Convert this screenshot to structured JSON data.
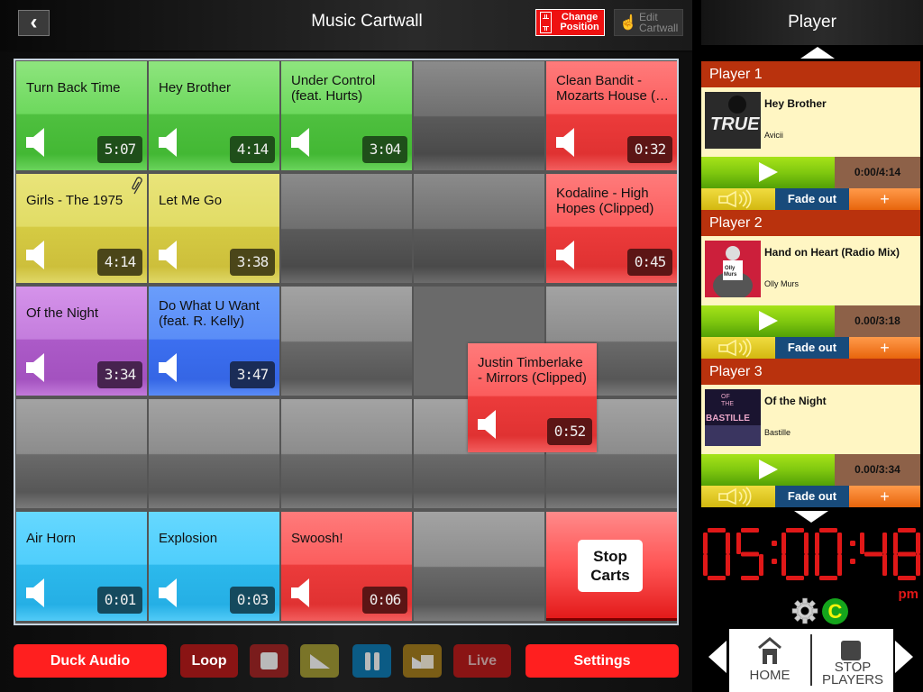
{
  "header": {
    "title": "Music Cartwall",
    "back_label": "‹",
    "change_position_label": "Change Position",
    "edit_cartwall_label": "Edit Cartwall"
  },
  "grid": {
    "cells": [
      {
        "name": "Turn Back Time",
        "duration": "5:07",
        "color": "green"
      },
      {
        "name": "Hey Brother",
        "duration": "4:14",
        "color": "green"
      },
      {
        "name": "Under Control (feat. Hurts)",
        "duration": "3:04",
        "color": "green"
      },
      {
        "name": "",
        "duration": "",
        "color": "empty"
      },
      {
        "name": "Clean Bandit - Mozarts House (…",
        "duration": "0:32",
        "color": "red"
      },
      {
        "name": "Girls - The 1975",
        "duration": "4:14",
        "color": "yellow",
        "attachment": true
      },
      {
        "name": "Let Me Go",
        "duration": "3:38",
        "color": "yellow"
      },
      {
        "name": "",
        "duration": "",
        "color": "empty"
      },
      {
        "name": "",
        "duration": "",
        "color": "empty"
      },
      {
        "name": "Kodaline - High Hopes (Clipped)",
        "duration": "0:45",
        "color": "red"
      },
      {
        "name": "Of the Night",
        "duration": "3:34",
        "color": "purple"
      },
      {
        "name": "Do What U Want (feat. R. Kelly)",
        "duration": "3:47",
        "color": "blue"
      },
      {
        "name": "",
        "duration": "",
        "color": "empty"
      },
      {
        "name": "",
        "duration": "",
        "color": "hole"
      },
      {
        "name": "",
        "duration": "",
        "color": "empty"
      },
      {
        "name": "",
        "duration": "",
        "color": "empty"
      },
      {
        "name": "",
        "duration": "",
        "color": "empty"
      },
      {
        "name": "",
        "duration": "",
        "color": "empty"
      },
      {
        "name": "",
        "duration": "",
        "color": "empty"
      },
      {
        "name": "",
        "duration": "",
        "color": "empty"
      },
      {
        "name": "Air Horn",
        "duration": "0:01",
        "color": "cyan"
      },
      {
        "name": "Explosion",
        "duration": "0:03",
        "color": "cyan"
      },
      {
        "name": "Swoosh!",
        "duration": "0:06",
        "color": "red"
      },
      {
        "name": "",
        "duration": "",
        "color": "empty"
      },
      {
        "name": "Stop Carts",
        "duration": "",
        "color": "stop"
      }
    ],
    "dragging": {
      "name": "Justin Timberlake - Mirrors (Clipped)",
      "duration": "0:52",
      "color": "red"
    },
    "stop_carts_label": "Stop Carts"
  },
  "toolbar": {
    "duck_audio": "Duck Audio",
    "loop": "Loop",
    "live": "Live",
    "settings": "Settings"
  },
  "player_panel": {
    "title": "Player",
    "players": [
      {
        "label": "Player 1",
        "song": "Hey Brother",
        "artist": "Avicii",
        "time": "0:00/4:14",
        "fade_label": "Fade out",
        "plus_label": "+"
      },
      {
        "label": "Player 2",
        "song": "Hand on Heart (Radio Mix)",
        "artist": "Olly Murs",
        "time": "0.00/3:18",
        "fade_label": "Fade out",
        "plus_label": "+"
      },
      {
        "label": "Player 3",
        "song": "Of the Night",
        "artist": "Bastille",
        "time": "0.00/3:34",
        "fade_label": "Fade out",
        "plus_label": "+"
      }
    ],
    "clock": {
      "time": "05:00:48",
      "ampm": "pm"
    },
    "status_badge": "C",
    "nav": {
      "home": "HOME",
      "stop_players": "STOP PLAYERS"
    }
  },
  "colors": {
    "accent_red": "#ff1f1f",
    "player_header": "#b9320d",
    "clock": "#e01818"
  }
}
